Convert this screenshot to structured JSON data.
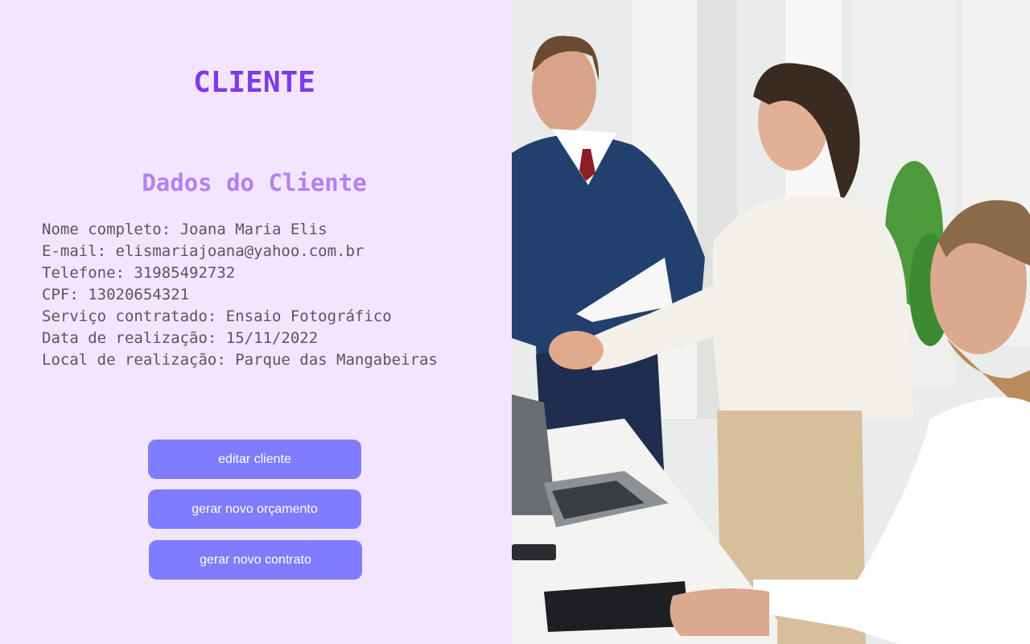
{
  "header": {
    "title": "CLIENTE"
  },
  "client": {
    "section_title": "Dados do Cliente",
    "fields": [
      "Nome completo: Joana Maria Elis",
      "E-mail: elismariajoana@yahoo.com.br",
      "Telefone: 31985492732",
      "CPF: 13020654321",
      "Serviço contratado: Ensaio Fotográfico",
      "Data de realização: 15/11/2022",
      "Local de realização: Parque das Mangabeiras"
    ]
  },
  "actions": {
    "edit_label": "editar cliente",
    "budget_label": "gerar novo orçamento",
    "contract_label": "gerar novo contrato"
  },
  "colors": {
    "background": "#f3e5ff",
    "title": "#7c3aed",
    "section_title": "#b380f0",
    "button": "#7f7cff"
  }
}
